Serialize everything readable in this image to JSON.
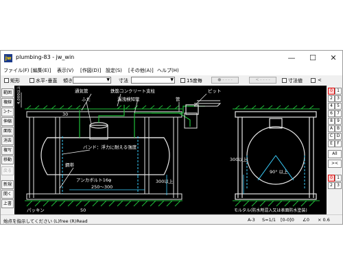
{
  "window": {
    "title": "plumbing-83 - jw_win",
    "app_icon": "jw",
    "controls": {
      "minimize": "—",
      "maximize": "☐",
      "close": "✕"
    }
  },
  "menu": [
    {
      "label": "ファイル(F)"
    },
    {
      "label": "[編集(E)]"
    },
    {
      "label": "表示(V)"
    },
    {
      "label": "[作図(D)]"
    },
    {
      "label": "設定(S)"
    },
    {
      "label": "[その他(A)]"
    },
    {
      "label": "ヘルプ(H)"
    }
  ],
  "toolbar": {
    "rect_label": "矩形",
    "hv_label": "水平･垂直",
    "slope_label": "傾き",
    "size_label": "寸法",
    "deg15_label": "15度毎",
    "dim_value_label": "寸法値",
    "lt_label": "<"
  },
  "left_tools": [
    {
      "label": "範囲"
    },
    {
      "label": "複線"
    },
    {
      "label": "ｺｰﾅｰ"
    },
    {
      "label": "伸縮"
    },
    {
      "label": "面取"
    },
    {
      "label": "消去"
    },
    {
      "label": "複写"
    },
    {
      "label": "移動"
    },
    {
      "label": "戻る",
      "disabled": true
    },
    {
      "label": "新規"
    },
    {
      "label": "開く"
    },
    {
      "label": "上書"
    }
  ],
  "right_tools": {
    "layer_buttons": [
      "0",
      "1",
      "2",
      "3",
      "4",
      "5",
      "6",
      "7",
      "8",
      "9",
      "A",
      "B",
      "C",
      "D",
      "E",
      "F"
    ],
    "all_label": "All",
    "swap_label": "><",
    "group_buttons": [
      "0",
      "1",
      "2",
      "3"
    ]
  },
  "drawing": {
    "labels": {
      "depth": "4,000以上",
      "vent_pipe": "通気管",
      "lid": "ふた",
      "rc_support": "鉄筋コンクリート支柱",
      "leak_pipe": "漏洩検知管",
      "pit": "ピット",
      "pipe": "管",
      "band": "バンド：浮力に耐える強度",
      "tank": "鋼帯",
      "anchor": "アンカボルト16φ",
      "range_250_300": "250～300",
      "min300_a": "300以上",
      "min300_b": "300以上",
      "dim_30": "30",
      "dim_50": "50",
      "packing": "パッキン",
      "angle": "90°\n以上",
      "mortar": "モルタル(防水剤混入又は表面防水塗装)"
    }
  },
  "statusbar": {
    "prompt": "始点を指示してください (L)free (R)Read",
    "paper": "A-3",
    "scale": "S=1/1",
    "layer": "[0-0]0",
    "angle": "∠0",
    "zoom": "× 0.6"
  }
}
